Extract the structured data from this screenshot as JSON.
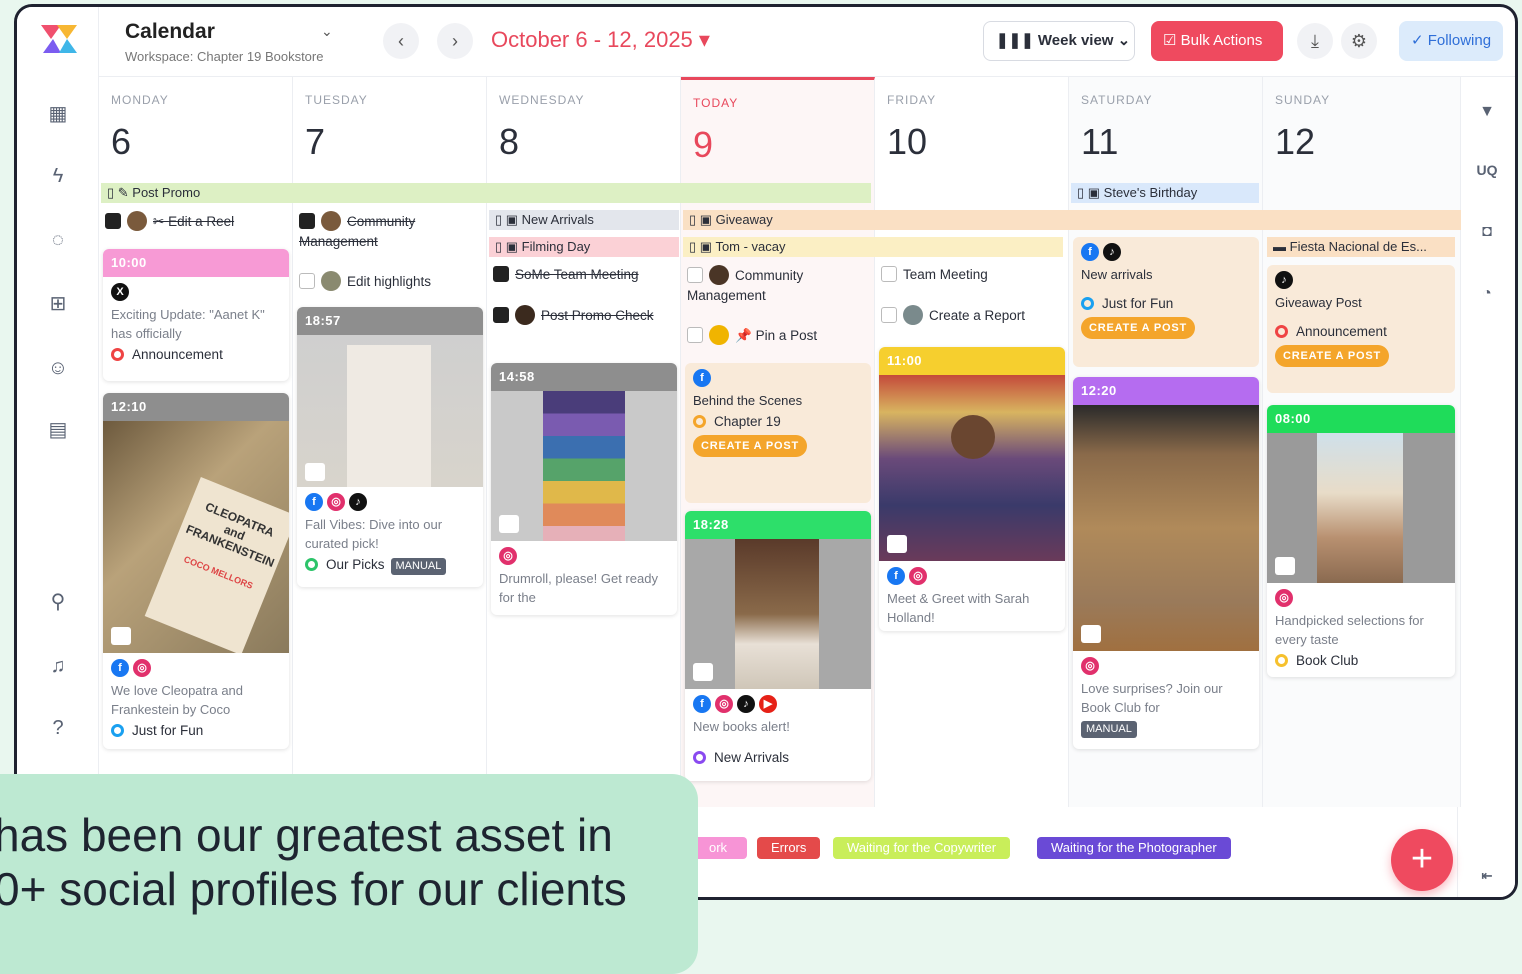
{
  "header": {
    "title": "Calendar",
    "workspace": "Workspace: Chapter 19 Bookstore",
    "date_range": "October 6 - 12, 2025",
    "view": "Week view",
    "bulk": "Bulk Actions",
    "following": "Following"
  },
  "colors": {
    "accent": "#e8485c",
    "brand_green": "#bde9d2"
  },
  "right_bar": {
    "uq": "UQ"
  },
  "days": [
    {
      "name": "MONDAY",
      "num": "6"
    },
    {
      "name": "TUESDAY",
      "num": "7"
    },
    {
      "name": "WEDNESDAY",
      "num": "8"
    },
    {
      "name": "TODAY",
      "num": "9"
    },
    {
      "name": "FRIDAY",
      "num": "10"
    },
    {
      "name": "SATURDAY",
      "num": "11"
    },
    {
      "name": "SUNDAY",
      "num": "12"
    }
  ],
  "bars": {
    "post_promo": "Post Promo",
    "new_arrivals": "New Arrivals",
    "filming_day": "Filming Day",
    "giveaway": "Giveaway",
    "tom_vacay": "Tom - vacay",
    "steves_birthday": "Steve's Birthday",
    "fiesta": "Fiesta Nacional de Es..."
  },
  "tasks": {
    "edit_reel": "Edit a Reel",
    "community_mgmt_done": "Community Management",
    "edit_highlights": "Edit highlights",
    "some_meeting": "SoMe Team Meeting",
    "post_promo_check": "Post Promo Check",
    "community_mgmt": "Community Management",
    "pin_post": "Pin a Post",
    "team_meeting": "Team Meeting",
    "create_report": "Create a Report"
  },
  "cards": {
    "mon1": {
      "time": "10:00",
      "text": "Exciting Update: \"Aanet K\" has officially",
      "cat": "Announcement"
    },
    "mon2": {
      "time": "12:10",
      "text": "We love Cleopatra and Frankestein by Coco",
      "cat": "Just for Fun",
      "book": "CLEOPATRA and FRANKENSTEIN",
      "author": "COCO MELLORS"
    },
    "tue1": {
      "time": "18:57",
      "text": "Fall Vibes: Dive into our curated pick!",
      "cat": "Our Picks",
      "manual": "MANUAL"
    },
    "wed1": {
      "time": "14:58",
      "text": "Drumroll, please! Get ready for the"
    },
    "thu1": {
      "text": "Behind the Scenes",
      "cat": "Chapter 19",
      "btn": "CREATE A POST"
    },
    "thu2": {
      "time": "18:28",
      "text": "New books alert!",
      "cat": "New Arrivals"
    },
    "fri1": {
      "time": "11:00",
      "text": "Meet & Greet with Sarah Holland!"
    },
    "sat1": {
      "text": "New arrivals",
      "cat": "Just for Fun",
      "btn": "CREATE A POST"
    },
    "sat2": {
      "time": "12:20",
      "text": "Love surprises? Join our Book Club for",
      "manual": "MANUAL"
    },
    "sun1": {
      "text": "Giveaway Post",
      "cat": "Announcement",
      "btn": "CREATE A POST"
    },
    "sun2": {
      "time": "08:00",
      "text": "Handpicked selections for every taste",
      "cat": "Book Club"
    }
  },
  "legend": [
    "ork",
    "Errors",
    "Waiting for the Copywriter",
    "Waiting for the Photographer"
  ],
  "quote": {
    "line1": "has been our greatest asset in",
    "line2": "0+ social profiles for our clients"
  }
}
